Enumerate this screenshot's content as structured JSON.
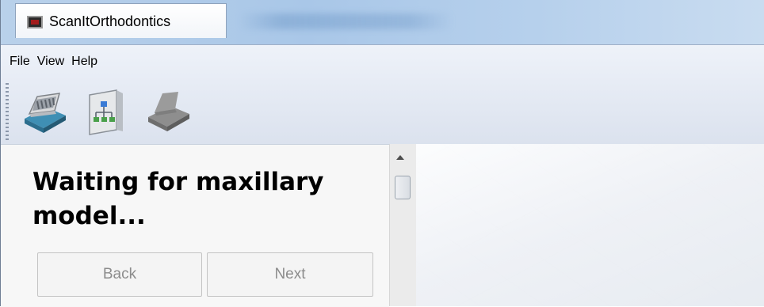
{
  "window": {
    "title": "ScanItOrthodontics"
  },
  "menu": {
    "items": [
      "File",
      "View",
      "Help"
    ]
  },
  "toolbar": {
    "buttons": [
      {
        "icon": "scanner-icon",
        "state": "enabled"
      },
      {
        "icon": "hierarchy-document-icon",
        "state": "enabled"
      },
      {
        "icon": "model-icon",
        "state": "disabled"
      }
    ]
  },
  "panel": {
    "status": "Waiting for maxillary model...",
    "back_label": "Back",
    "next_label": "Next"
  },
  "colors": {
    "titlebar": "#b9d1ea",
    "panel_bg": "#f7f7f7",
    "disabled_text": "#8c8c8c"
  }
}
